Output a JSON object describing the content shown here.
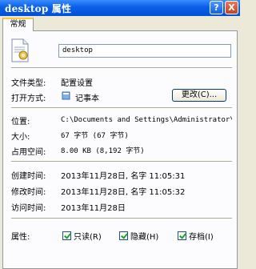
{
  "window": {
    "title": "desktop 属性",
    "help_label": "?",
    "close_label": "X"
  },
  "tabs": [
    {
      "label": "常规"
    }
  ],
  "general": {
    "file_name": "desktop",
    "file_type_label": "文件类型:",
    "file_type_value": "配置设置",
    "open_with_label": "打开方式:",
    "open_with_value": "记事本",
    "change_button": "更改(C)...",
    "location_label": "位置:",
    "location_value": "C:\\Documents and Settings\\Administrator\\桌面",
    "size_label": "大小:",
    "size_value": "67 字节 (67 字节)",
    "disk_size_label": "占用空间:",
    "disk_size_value": "8.00 KB (8,192 字节)",
    "created_label": "创建时间:",
    "created_value": "2013年11月28日, 名字 11:05:31",
    "modified_label": "修改时间:",
    "modified_value": "2013年11月28日, 名字 11:05:32",
    "accessed_label": "访问时间:",
    "accessed_value": "2013年11月28日",
    "attributes_label": "属性:",
    "attributes": [
      {
        "label": "只读(R)",
        "checked": true
      },
      {
        "label": "隐藏(H)",
        "checked": true
      },
      {
        "label": "存档(I)",
        "checked": true
      }
    ]
  }
}
